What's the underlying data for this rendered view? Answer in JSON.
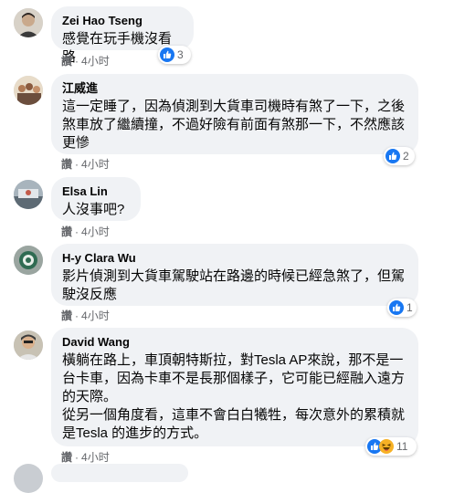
{
  "comments": [
    {
      "name": "Zei Hao Tseng",
      "text": "感覺在玩手機沒看路",
      "like_label": "讚",
      "time": "4小时",
      "reaction_count": "3",
      "reactions": [
        "like-icon"
      ]
    },
    {
      "name": "江威進",
      "text": "這一定睡了，因為偵測到大貨車司機時有煞了一下，之後\n煞車放了繼續撞，不過好險有前面有煞那一下，不然應該\n更慘",
      "like_label": "讚",
      "time": "4小时",
      "reaction_count": "2",
      "reactions": [
        "like-icon"
      ]
    },
    {
      "name": "Elsa Lin",
      "text": "人沒事吧?",
      "like_label": "讚",
      "time": "4小时",
      "reaction_count": "",
      "reactions": []
    },
    {
      "name": "H-y Clara Wu",
      "text": "影片偵測到大貨車駕駛站在路邊的時候已經急煞了，但駕\n駛沒反應",
      "like_label": "讚",
      "time": "4小时",
      "reaction_count": "1",
      "reactions": [
        "like-icon"
      ]
    },
    {
      "name": "David Wang",
      "text": "橫躺在路上，車頂朝特斯拉，對Tesla AP來說，那不是一\n台卡車，因為卡車不是長那個樣子，它可能已經融入遠方\n的天際。\n從另一個角度看，這車不會白白犧牲，每次意外的累積就\n是Tesla 的進步的方式。",
      "like_label": "讚",
      "time": "4小时",
      "reaction_count": "11",
      "reactions": [
        "like-icon",
        "haha-icon"
      ]
    }
  ],
  "colors": {
    "bubble": "#f0f2f5",
    "like_blue": "#1877f2",
    "meta_gray": "#65676b",
    "text": "#050505"
  }
}
